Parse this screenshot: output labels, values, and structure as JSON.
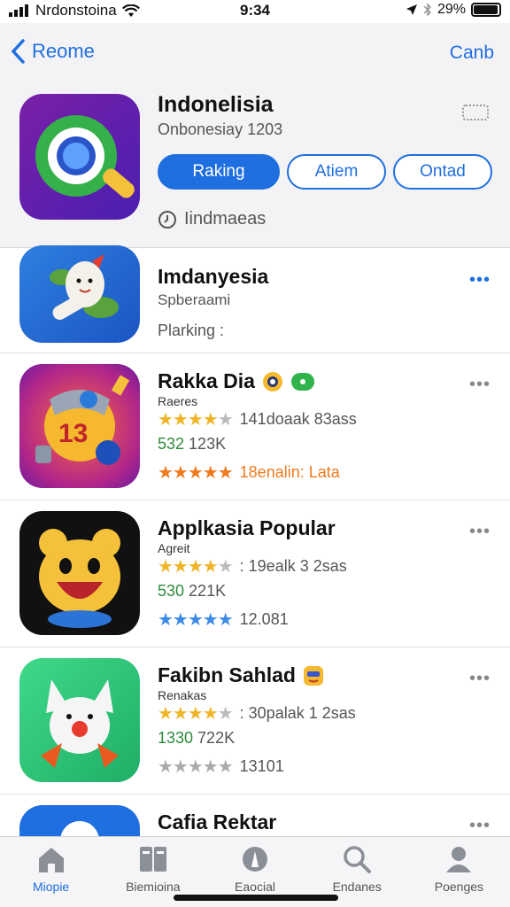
{
  "status": {
    "carrier": "Nrdonstoina",
    "time": "9:34",
    "battery": "29%"
  },
  "nav": {
    "back_label": "Reome",
    "right_label": "Canb"
  },
  "header_app": {
    "title": "Indonelisia",
    "subtitle": "Onbonesiay 1203",
    "buttons": [
      "Raking",
      "Atiem",
      "Ontad"
    ],
    "meta": "Iindmaeas"
  },
  "apps": [
    {
      "title": "Imdanyesia",
      "sub1": "Spberaami",
      "sub2": "Plarking :"
    },
    {
      "title": "Rakka Dia",
      "sub": "Raeres",
      "rating_text": "141doaak 83ass",
      "green_num": "532",
      "green_rest": " 123K",
      "rating2_text": "18enalin: Lata"
    },
    {
      "title": "Applkasia Popular",
      "sub": "Agreit",
      "rating_text": ": 19ealk 3 2sas",
      "green_num": "530",
      "green_rest": " 221K",
      "rating2_text": "12.081"
    },
    {
      "title": "Fakibn Sahlad",
      "sub": "Renakas",
      "rating_text": ": 30palak 1 2sas",
      "green_num": "1330",
      "green_rest": " 722K",
      "rating2_text": "13101"
    },
    {
      "title": "Cafia Rektar"
    }
  ],
  "tabs": [
    "Miopie",
    "Biemioina",
    "Eaocial",
    "Endanes",
    "Poenges"
  ],
  "colors": {
    "accent": "#1f6fe0",
    "star_gold": "#f0b429",
    "star_orange": "#f07a1e",
    "star_blue": "#3d8be6",
    "green": "#2e8b3a"
  }
}
